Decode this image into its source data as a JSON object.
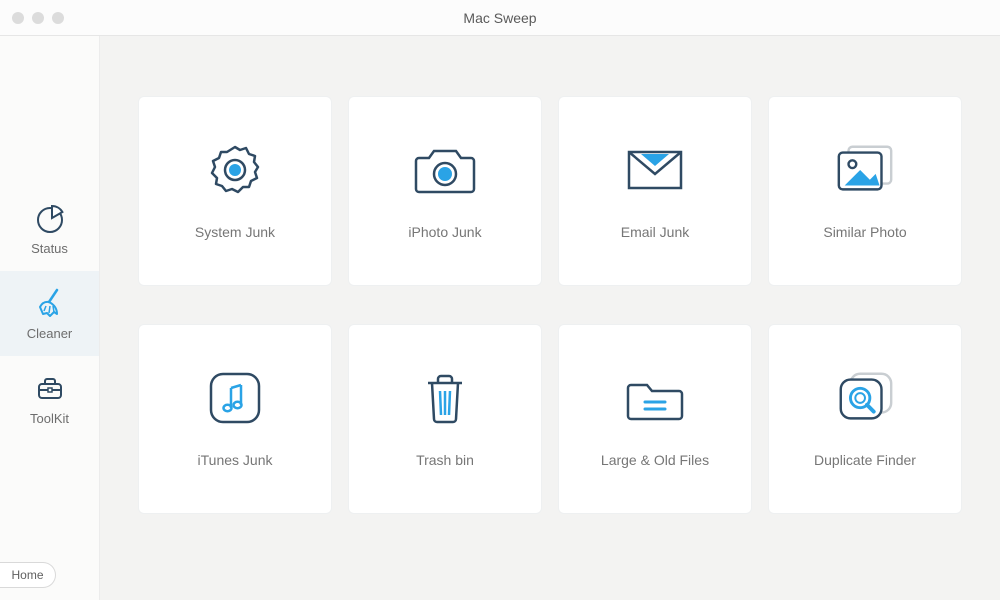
{
  "window": {
    "title": "Mac Sweep"
  },
  "sidebar": {
    "items": [
      {
        "label": "Status"
      },
      {
        "label": "Cleaner"
      },
      {
        "label": "ToolKit"
      }
    ],
    "home_label": "Home"
  },
  "tiles": [
    {
      "label": "System Junk"
    },
    {
      "label": "iPhoto Junk"
    },
    {
      "label": "Email Junk"
    },
    {
      "label": "Similar Photo"
    },
    {
      "label": "iTunes Junk"
    },
    {
      "label": "Trash bin"
    },
    {
      "label": "Large & Old Files"
    },
    {
      "label": "Duplicate Finder"
    }
  ],
  "colors": {
    "accent": "#2aa3e6",
    "stroke": "#2f4a63"
  }
}
